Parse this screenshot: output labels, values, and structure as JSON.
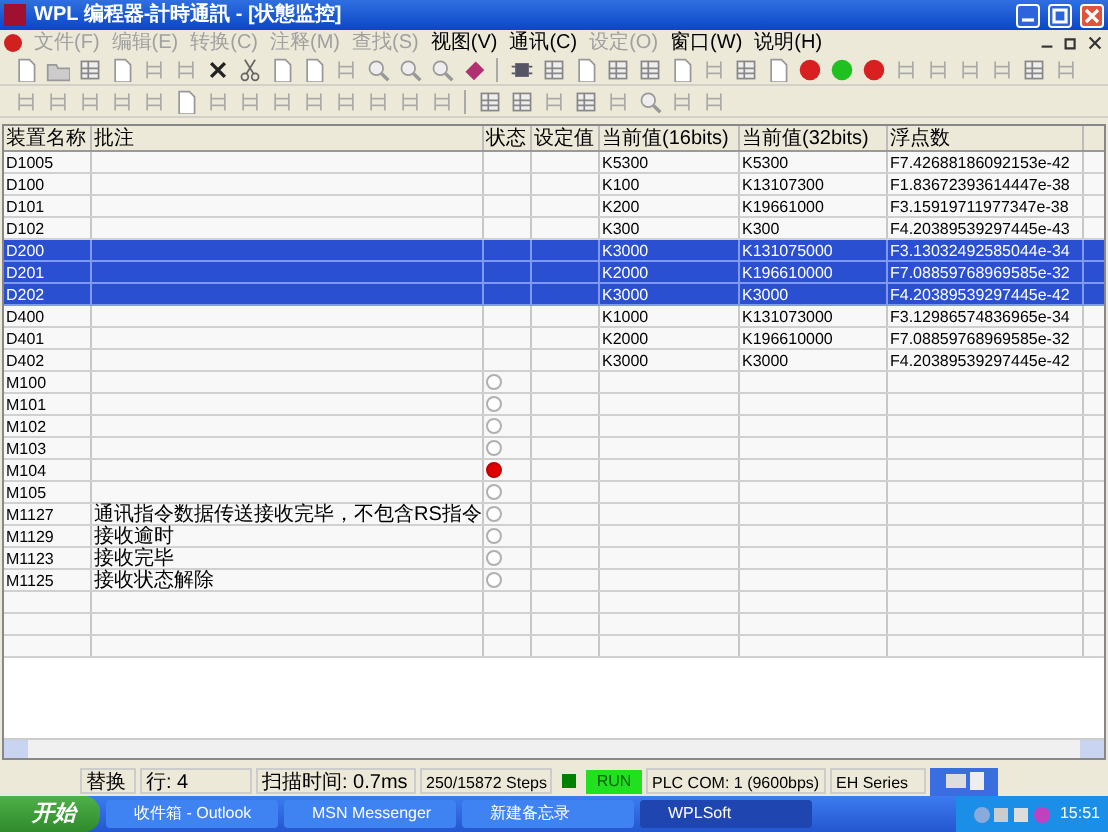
{
  "window": {
    "title": "WPL 编程器-計時通訊 - [状態监控]"
  },
  "menu": [
    {
      "label": "文件(F)",
      "disabled": true
    },
    {
      "label": "编辑(E)",
      "disabled": true
    },
    {
      "label": "转换(C)",
      "disabled": true
    },
    {
      "label": "注释(M)",
      "disabled": true
    },
    {
      "label": "查找(S)",
      "disabled": true
    },
    {
      "label": "视图(V)",
      "disabled": false
    },
    {
      "label": "通讯(C)",
      "disabled": false
    },
    {
      "label": "设定(O)",
      "disabled": true
    },
    {
      "label": "窗口(W)",
      "disabled": false
    },
    {
      "label": "说明(H)",
      "disabled": false
    }
  ],
  "table": {
    "columns": [
      "装置名称",
      "批注",
      "状态",
      "设定值",
      "当前值(16bits)",
      "当前值(32bits)",
      "浮点数"
    ],
    "rows": [
      {
        "name": "D1005",
        "comment": "",
        "v16": "K5300",
        "v32": "K5300",
        "float": "F7.42688186092153e-42",
        "selected": false
      },
      {
        "name": "D100",
        "comment": "",
        "v16": "K100",
        "v32": "K13107300",
        "float": "F1.83672393614447e-38",
        "selected": false
      },
      {
        "name": "D101",
        "comment": "",
        "v16": "K200",
        "v32": "K19661000",
        "float": "F3.15919711977347e-38",
        "selected": false
      },
      {
        "name": "D102",
        "comment": "",
        "v16": "K300",
        "v32": "K300",
        "float": "F4.20389539297445e-43",
        "selected": false
      },
      {
        "name": "D200",
        "comment": "",
        "v16": "K3000",
        "v32": "K131075000",
        "float": "F3.13032492585044e-34",
        "selected": true
      },
      {
        "name": "D201",
        "comment": "",
        "v16": "K2000",
        "v32": "K196610000",
        "float": "F7.08859768969585e-32",
        "selected": true
      },
      {
        "name": "D202",
        "comment": "",
        "v16": "K3000",
        "v32": "K3000",
        "float": "F4.20389539297445e-42",
        "selected": true
      },
      {
        "name": "D400",
        "comment": "",
        "v16": "K1000",
        "v32": "K131073000",
        "float": "F3.12986574836965e-34",
        "selected": false
      },
      {
        "name": "D401",
        "comment": "",
        "v16": "K2000",
        "v32": "K196610000",
        "float": "F7.08859768969585e-32",
        "selected": false
      },
      {
        "name": "D402",
        "comment": "",
        "v16": "K3000",
        "v32": "K3000",
        "float": "F4.20389539297445e-42",
        "selected": false
      },
      {
        "name": "M100",
        "comment": "",
        "on": false,
        "selected": false
      },
      {
        "name": "M101",
        "comment": "",
        "on": false,
        "selected": false
      },
      {
        "name": "M102",
        "comment": "",
        "on": false,
        "selected": false
      },
      {
        "name": "M103",
        "comment": "",
        "on": false,
        "selected": false
      },
      {
        "name": "M104",
        "comment": "",
        "on": true,
        "selected": false
      },
      {
        "name": "M105",
        "comment": "",
        "on": false,
        "selected": false
      },
      {
        "name": "M1127",
        "comment": "通讯指令数据传送接收完毕，不包含RS指令",
        "on": false,
        "selected": false
      },
      {
        "name": "M1129",
        "comment": "接收逾时",
        "on": false,
        "selected": false
      },
      {
        "name": "M1123",
        "comment": "接收完毕",
        "on": false,
        "selected": false
      },
      {
        "name": "M1125",
        "comment": "接收状态解除",
        "on": false,
        "selected": false
      }
    ]
  },
  "status_bar": {
    "mode": "替换",
    "line": "行: 4",
    "scan_time": "扫描时间: 0.7ms",
    "steps": "250/15872 Steps",
    "run": "RUN",
    "com": "PLC COM: 1 (9600bps)",
    "series": "EH Series"
  },
  "taskbar": {
    "start": "开始",
    "tasks": [
      {
        "label": "收件箱 - Outlook",
        "selected": false
      },
      {
        "label": "MSN Messenger",
        "selected": false
      },
      {
        "label": "新建备忘录",
        "selected": false
      },
      {
        "label": "WPLSoft",
        "selected": true
      }
    ],
    "clock": "15:51"
  }
}
